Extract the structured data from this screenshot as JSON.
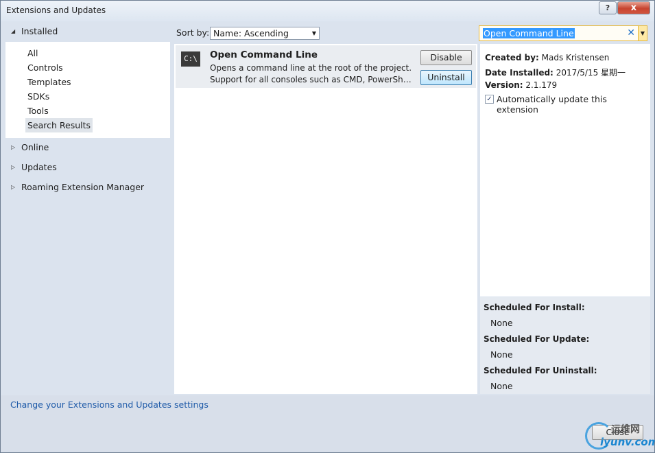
{
  "window": {
    "title": "Extensions and Updates",
    "help_label": "?",
    "close_label": "x"
  },
  "nav": {
    "installed": {
      "label": "Installed",
      "expanded": true
    },
    "installed_items": [
      "All",
      "Controls",
      "Templates",
      "SDKs",
      "Tools",
      "Search Results"
    ],
    "selected_item": "Search Results",
    "sections": [
      "Online",
      "Updates",
      "Roaming Extension Manager"
    ]
  },
  "toolbar": {
    "sort_label": "Sort by:",
    "sort_value": "Name: Ascending",
    "search_value": "Open Command Line"
  },
  "extension": {
    "icon_text": "C:\\",
    "name": "Open Command Line",
    "desc_line1": "Opens a command line at the root of the project.",
    "desc_line2": "Support for all consoles such as CMD, PowerShe...",
    "disable_label": "Disable",
    "uninstall_label": "Uninstall"
  },
  "details": {
    "created_by_label": "Created by:",
    "created_by": "Mads Kristensen",
    "date_installed_label": "Date Installed:",
    "date_installed": "2017/5/15 星期一",
    "version_label": "Version:",
    "version": "2.1.179",
    "auto_update_label": "Automatically update this extension",
    "auto_update_checked": true,
    "check_glyph": "✓"
  },
  "scheduled": {
    "install_label": "Scheduled For Install:",
    "install_value": "None",
    "update_label": "Scheduled For Update:",
    "update_value": "None",
    "uninstall_label": "Scheduled For Uninstall:",
    "uninstall_value": "None"
  },
  "footer": {
    "settings_link": "Change your Extensions and Updates settings",
    "close_label": "Close"
  },
  "watermark": {
    "line1": "运维网",
    "line2": "iyunv.com"
  }
}
